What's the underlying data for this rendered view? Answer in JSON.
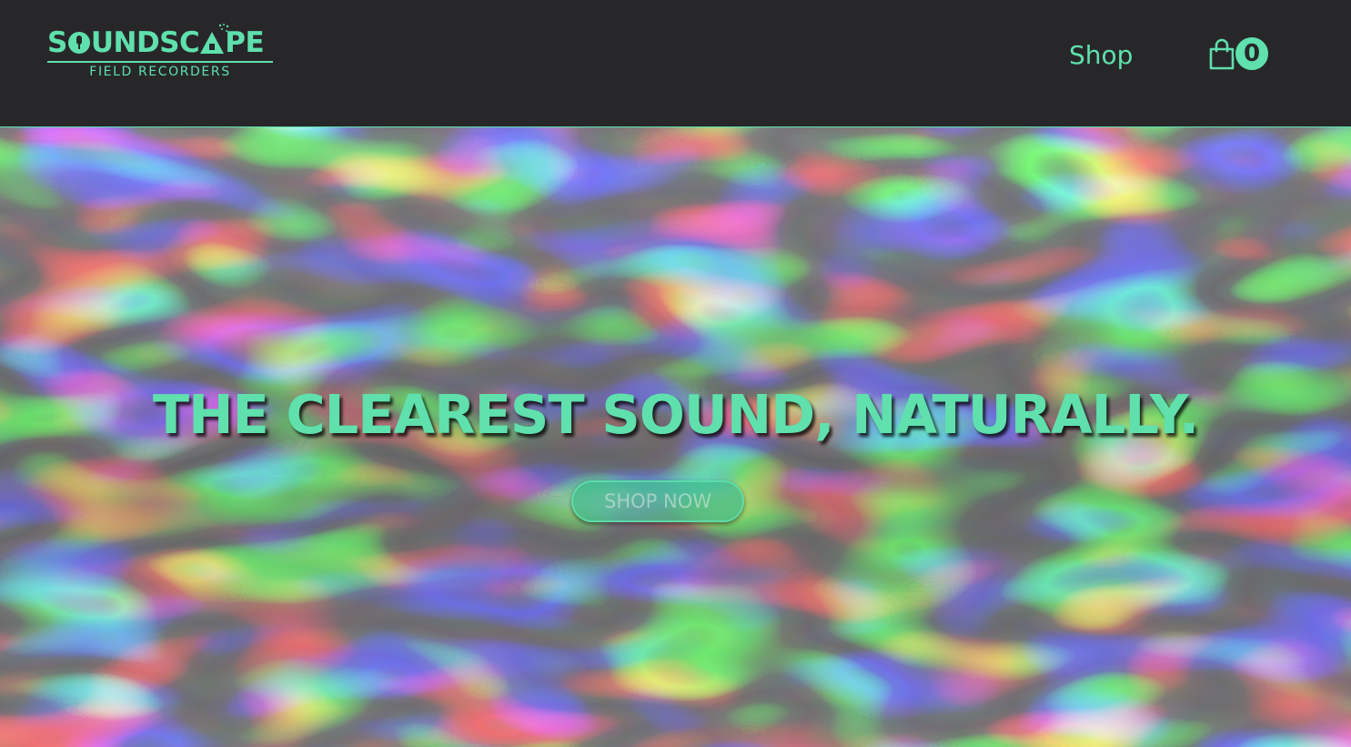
{
  "brand": {
    "name_part1": "S",
    "name_part2": "UNDSC",
    "name_part3": "PE",
    "tagline": "FIELD RECORDERS"
  },
  "nav": {
    "shop_label": "Shop"
  },
  "cart": {
    "count": "0",
    "icon": "shopping-bag-icon"
  },
  "hero": {
    "headline": "THE CLEAREST SOUND, NATURALLY.",
    "cta_label": "SHOP NOW",
    "background": "water-ripples-image"
  },
  "colors": {
    "accent": "#5fe0ad",
    "header_bg": "#272729"
  }
}
